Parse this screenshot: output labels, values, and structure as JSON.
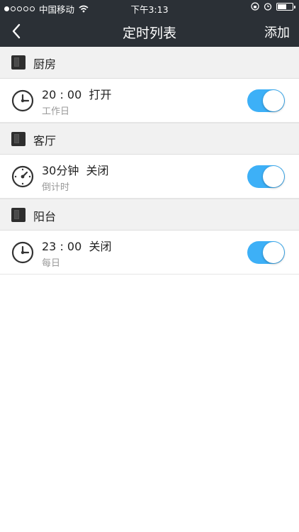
{
  "status_bar": {
    "carrier": "中国移动",
    "time": "下午3:13"
  },
  "nav": {
    "title": "定时列表",
    "action": "添加"
  },
  "colors": {
    "header_bg": "#2b3036",
    "toggle_on": "#3db0f7",
    "section_bg": "#f1f1f1"
  },
  "sections": [
    {
      "device": "厨房",
      "timers": [
        {
          "main": "20 : 00  打开",
          "sub": "工作日",
          "icon": "clock-icon",
          "enabled": true
        }
      ]
    },
    {
      "device": "客厅",
      "timers": [
        {
          "main": "30分钟  关闭",
          "sub": "倒计时",
          "icon": "countdown-icon",
          "enabled": true
        }
      ]
    },
    {
      "device": "阳台",
      "timers": [
        {
          "main": "23 : 00  关闭",
          "sub": "每日",
          "icon": "clock-icon",
          "enabled": true
        }
      ]
    }
  ]
}
